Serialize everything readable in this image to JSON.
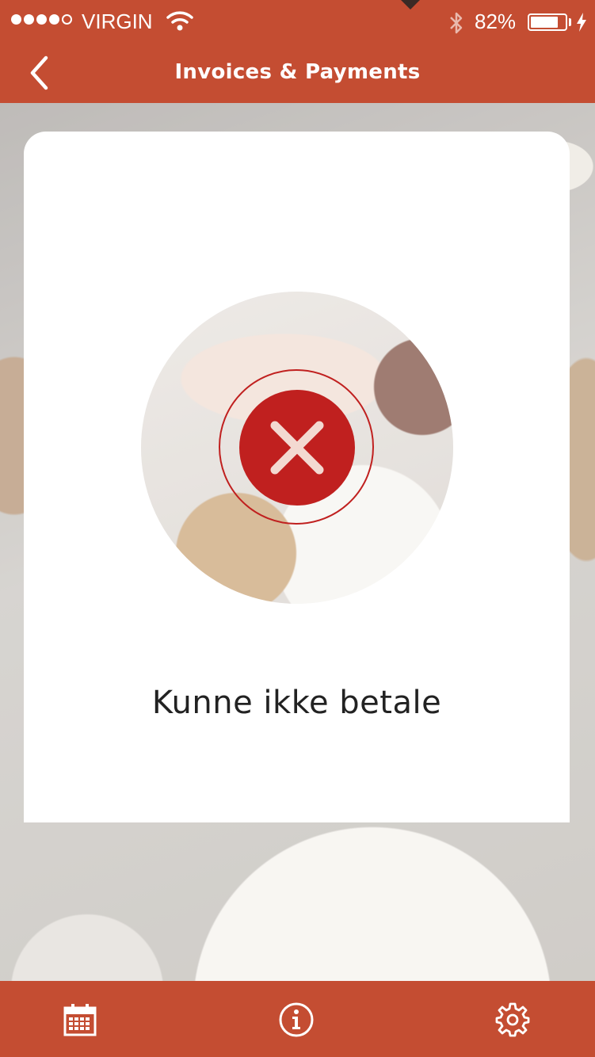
{
  "status_bar": {
    "carrier": "VIRGIN",
    "battery_percent": "82%",
    "battery_level": 0.82,
    "signal_bars": 4,
    "signal_total": 5
  },
  "nav": {
    "title": "Invoices & Payments",
    "back_icon": "chevron-left-icon"
  },
  "card": {
    "status_icon": "error-x-icon",
    "message": "Kunne ikke betale"
  },
  "tab_bar": {
    "items": [
      {
        "icon": "calendar-icon"
      },
      {
        "icon": "info-icon"
      },
      {
        "icon": "gear-icon"
      }
    ]
  },
  "colors": {
    "brand": "#c44d32",
    "error": "#c0201f",
    "text": "#222222"
  }
}
